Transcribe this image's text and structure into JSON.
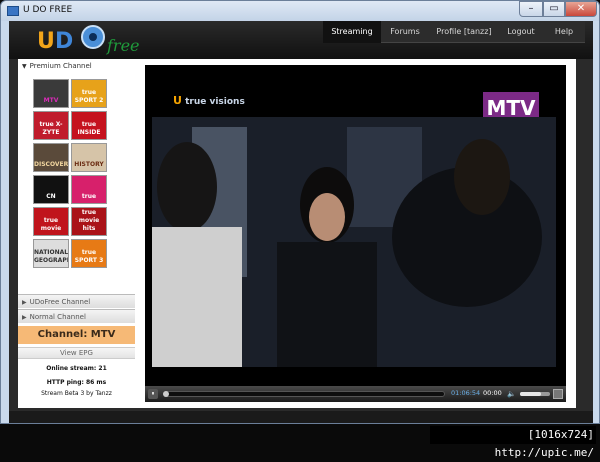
{
  "window": {
    "title": "U DO FREE",
    "min_glyph": "–",
    "max_glyph": "▭",
    "close_glyph": "✕"
  },
  "nav": {
    "items": [
      {
        "label": "Streaming",
        "active": true
      },
      {
        "label": "Forums"
      },
      {
        "label": "Profile [tanzz]"
      },
      {
        "label": "Logout"
      },
      {
        "label": "Help"
      }
    ]
  },
  "logo": {
    "u": "U",
    "d": "D",
    "script": "free"
  },
  "sidebar": {
    "premium_label": "Premium Channel",
    "udofree_label": "UDoFree Channel",
    "normal_label": "Normal Channel",
    "tiles": [
      {
        "name": "mtv",
        "label": "MTV",
        "bg": "#3a3a3a",
        "fg": "#d92bb8"
      },
      {
        "name": "true-sport-2",
        "label": "true SPORT 2",
        "bg": "#e7a21a",
        "fg": "#fff"
      },
      {
        "name": "true-x-zyte",
        "label": "true X-ZYTE",
        "bg": "#c01c2c",
        "fg": "#fff"
      },
      {
        "name": "true-inside",
        "label": "true INSIDE",
        "bg": "#c5121e",
        "fg": "#fff"
      },
      {
        "name": "discovery",
        "label": "DISCOVERY",
        "bg": "#5a4a3a",
        "fg": "#f2d7a0"
      },
      {
        "name": "history",
        "label": "HISTORY",
        "bg": "#d6c4a8",
        "fg": "#6b2c12"
      },
      {
        "name": "cartoon-network",
        "label": "CN",
        "bg": "#111",
        "fg": "#fff"
      },
      {
        "name": "true-spark",
        "label": "true",
        "bg": "#d7206b",
        "fg": "#fff"
      },
      {
        "name": "true-movie",
        "label": "true movie",
        "bg": "#c0141c",
        "fg": "#fff"
      },
      {
        "name": "true-movie-hits",
        "label": "true movie hits",
        "bg": "#aa1218",
        "fg": "#fff"
      },
      {
        "name": "national-geographic",
        "label": "NATIONAL GEOGRAPHIC",
        "bg": "#ddd",
        "fg": "#333"
      },
      {
        "name": "true-sport-3",
        "label": "true SPORT 3",
        "bg": "#e77a15",
        "fg": "#fff"
      }
    ],
    "current_channel": "Channel: MTV",
    "view_epg": "View EPG",
    "online_stream": "Online stream: 21",
    "http_ping": "HTTP ping: 86 ms",
    "version": "Stream Beta 3 by Tanzz"
  },
  "player": {
    "overlay_logo": "true visions",
    "overlay_logo_u": "U",
    "channel_badge": "MTV",
    "play_glyph": "⏸",
    "elapsed": "01:06:54",
    "total": "00:00",
    "speaker_glyph": "🔈",
    "progress": 0,
    "volume": 0.7
  },
  "watermark": "[1016x724] http://upic.me/",
  "colors": {
    "accent": "#f6b976",
    "nav_active_bg": "#111111"
  }
}
